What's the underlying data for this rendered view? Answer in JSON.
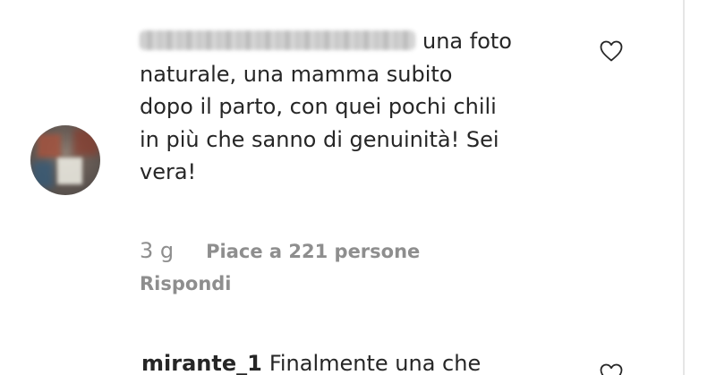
{
  "comment": {
    "username_blurred": true,
    "text": "una foto naturale, una mamma subito dopo il parto, con quei pochi chili in più che sanno di genuinità! Sei vera!",
    "lines": [
      "una foto",
      "naturale, una mamma subito",
      "dopo il parto, con quei pochi chili",
      "in più che sanno di genuinità! Sei",
      "vera!"
    ],
    "timestamp": "3 g",
    "likes_label": "Piace a 221 persone",
    "reply_label": "Rispondi",
    "like_icon": "heart-outline-icon"
  },
  "next_comment": {
    "username": "mirante_1",
    "text": "Finalmente una che",
    "like_icon": "heart-outline-icon"
  },
  "colors": {
    "text": "#262626",
    "secondary": "#8e8e8e",
    "divider": "#e6e6e6"
  }
}
